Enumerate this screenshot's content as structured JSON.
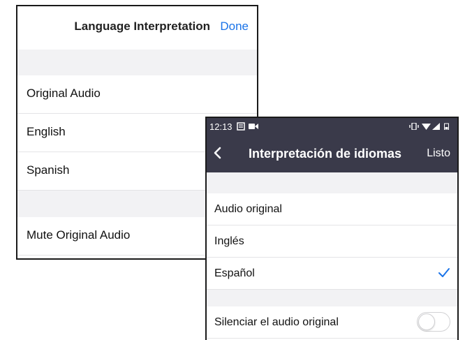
{
  "ios_panel": {
    "title": "Language Interpretation",
    "done_label": "Done",
    "items": [
      {
        "label": "Original Audio"
      },
      {
        "label": "English"
      },
      {
        "label": "Spanish"
      },
      {
        "label": "Mute Original Audio"
      }
    ]
  },
  "android_panel": {
    "status_bar": {
      "time": "12:13",
      "icons": [
        "notification-icon",
        "video-icon",
        "vibrate-icon",
        "wifi-icon",
        "signal-icon",
        "battery-icon"
      ]
    },
    "title": "Interpretación de idiomas",
    "done_label": "Listo",
    "items": [
      {
        "label": "Audio original"
      },
      {
        "label": "Inglés"
      },
      {
        "label": "Español",
        "selected": true
      },
      {
        "label": "Silenciar el audio original",
        "toggle": false
      }
    ]
  },
  "colors": {
    "accent": "#1a73e8",
    "android_bar": "#3a3a4a",
    "section_gap": "#f2f2f4"
  }
}
